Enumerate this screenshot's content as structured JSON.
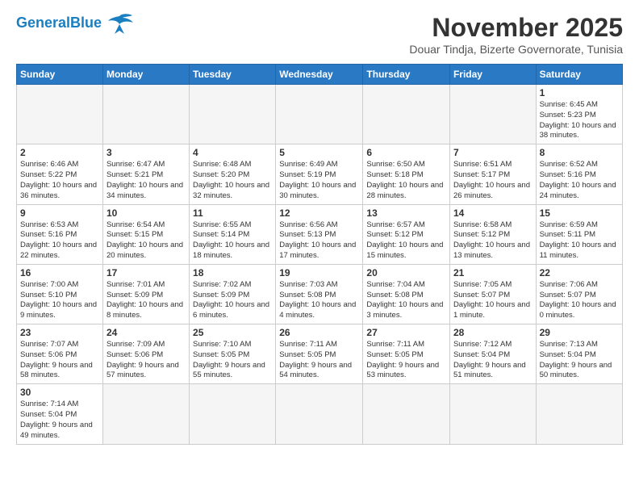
{
  "header": {
    "logo_general": "General",
    "logo_blue": "Blue",
    "month_title": "November 2025",
    "subtitle": "Douar Tindja, Bizerte Governorate, Tunisia"
  },
  "days_of_week": [
    "Sunday",
    "Monday",
    "Tuesday",
    "Wednesday",
    "Thursday",
    "Friday",
    "Saturday"
  ],
  "weeks": [
    [
      {
        "day": "",
        "info": ""
      },
      {
        "day": "",
        "info": ""
      },
      {
        "day": "",
        "info": ""
      },
      {
        "day": "",
        "info": ""
      },
      {
        "day": "",
        "info": ""
      },
      {
        "day": "",
        "info": ""
      },
      {
        "day": "1",
        "info": "Sunrise: 6:45 AM\nSunset: 5:23 PM\nDaylight: 10 hours and 38 minutes."
      }
    ],
    [
      {
        "day": "2",
        "info": "Sunrise: 6:46 AM\nSunset: 5:22 PM\nDaylight: 10 hours and 36 minutes."
      },
      {
        "day": "3",
        "info": "Sunrise: 6:47 AM\nSunset: 5:21 PM\nDaylight: 10 hours and 34 minutes."
      },
      {
        "day": "4",
        "info": "Sunrise: 6:48 AM\nSunset: 5:20 PM\nDaylight: 10 hours and 32 minutes."
      },
      {
        "day": "5",
        "info": "Sunrise: 6:49 AM\nSunset: 5:19 PM\nDaylight: 10 hours and 30 minutes."
      },
      {
        "day": "6",
        "info": "Sunrise: 6:50 AM\nSunset: 5:18 PM\nDaylight: 10 hours and 28 minutes."
      },
      {
        "day": "7",
        "info": "Sunrise: 6:51 AM\nSunset: 5:17 PM\nDaylight: 10 hours and 26 minutes."
      },
      {
        "day": "8",
        "info": "Sunrise: 6:52 AM\nSunset: 5:16 PM\nDaylight: 10 hours and 24 minutes."
      }
    ],
    [
      {
        "day": "9",
        "info": "Sunrise: 6:53 AM\nSunset: 5:16 PM\nDaylight: 10 hours and 22 minutes."
      },
      {
        "day": "10",
        "info": "Sunrise: 6:54 AM\nSunset: 5:15 PM\nDaylight: 10 hours and 20 minutes."
      },
      {
        "day": "11",
        "info": "Sunrise: 6:55 AM\nSunset: 5:14 PM\nDaylight: 10 hours and 18 minutes."
      },
      {
        "day": "12",
        "info": "Sunrise: 6:56 AM\nSunset: 5:13 PM\nDaylight: 10 hours and 17 minutes."
      },
      {
        "day": "13",
        "info": "Sunrise: 6:57 AM\nSunset: 5:12 PM\nDaylight: 10 hours and 15 minutes."
      },
      {
        "day": "14",
        "info": "Sunrise: 6:58 AM\nSunset: 5:12 PM\nDaylight: 10 hours and 13 minutes."
      },
      {
        "day": "15",
        "info": "Sunrise: 6:59 AM\nSunset: 5:11 PM\nDaylight: 10 hours and 11 minutes."
      }
    ],
    [
      {
        "day": "16",
        "info": "Sunrise: 7:00 AM\nSunset: 5:10 PM\nDaylight: 10 hours and 9 minutes."
      },
      {
        "day": "17",
        "info": "Sunrise: 7:01 AM\nSunset: 5:09 PM\nDaylight: 10 hours and 8 minutes."
      },
      {
        "day": "18",
        "info": "Sunrise: 7:02 AM\nSunset: 5:09 PM\nDaylight: 10 hours and 6 minutes."
      },
      {
        "day": "19",
        "info": "Sunrise: 7:03 AM\nSunset: 5:08 PM\nDaylight: 10 hours and 4 minutes."
      },
      {
        "day": "20",
        "info": "Sunrise: 7:04 AM\nSunset: 5:08 PM\nDaylight: 10 hours and 3 minutes."
      },
      {
        "day": "21",
        "info": "Sunrise: 7:05 AM\nSunset: 5:07 PM\nDaylight: 10 hours and 1 minute."
      },
      {
        "day": "22",
        "info": "Sunrise: 7:06 AM\nSunset: 5:07 PM\nDaylight: 10 hours and 0 minutes."
      }
    ],
    [
      {
        "day": "23",
        "info": "Sunrise: 7:07 AM\nSunset: 5:06 PM\nDaylight: 9 hours and 58 minutes."
      },
      {
        "day": "24",
        "info": "Sunrise: 7:09 AM\nSunset: 5:06 PM\nDaylight: 9 hours and 57 minutes."
      },
      {
        "day": "25",
        "info": "Sunrise: 7:10 AM\nSunset: 5:05 PM\nDaylight: 9 hours and 55 minutes."
      },
      {
        "day": "26",
        "info": "Sunrise: 7:11 AM\nSunset: 5:05 PM\nDaylight: 9 hours and 54 minutes."
      },
      {
        "day": "27",
        "info": "Sunrise: 7:11 AM\nSunset: 5:05 PM\nDaylight: 9 hours and 53 minutes."
      },
      {
        "day": "28",
        "info": "Sunrise: 7:12 AM\nSunset: 5:04 PM\nDaylight: 9 hours and 51 minutes."
      },
      {
        "day": "29",
        "info": "Sunrise: 7:13 AM\nSunset: 5:04 PM\nDaylight: 9 hours and 50 minutes."
      }
    ],
    [
      {
        "day": "30",
        "info": "Sunrise: 7:14 AM\nSunset: 5:04 PM\nDaylight: 9 hours and 49 minutes."
      },
      {
        "day": "",
        "info": ""
      },
      {
        "day": "",
        "info": ""
      },
      {
        "day": "",
        "info": ""
      },
      {
        "day": "",
        "info": ""
      },
      {
        "day": "",
        "info": ""
      },
      {
        "day": "",
        "info": ""
      }
    ]
  ]
}
